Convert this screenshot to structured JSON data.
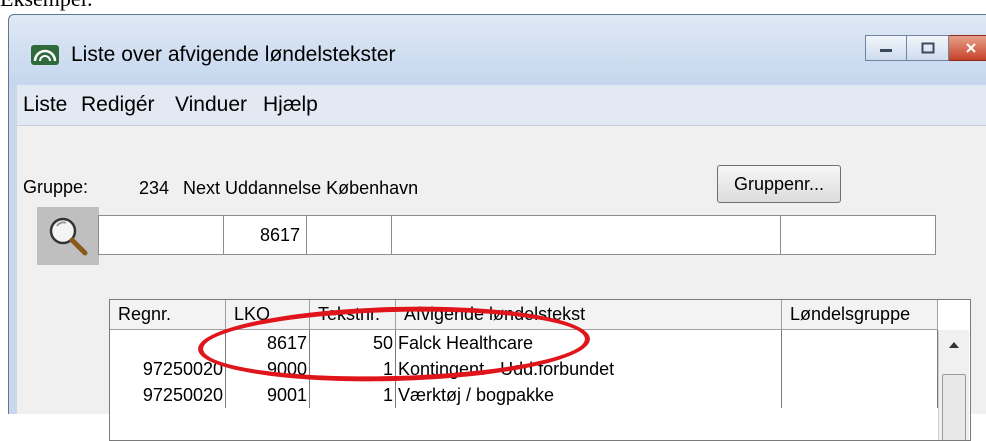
{
  "caption": "Eksempel:",
  "window": {
    "title": "Liste over afvigende løndelstekster",
    "app_icon": "app-logo-icon",
    "buttons": [
      "minimize-icon",
      "maximize-icon",
      "close-icon"
    ]
  },
  "menu": [
    "Liste",
    "Redigér",
    "Vinduer",
    "Hjælp"
  ],
  "group": {
    "label": "Gruppe:",
    "number": "234",
    "name": "Next Uddannelse København"
  },
  "group_button": "Gruppenr...",
  "filter": {
    "regnr": "",
    "lko": "8617",
    "tekstnr": "",
    "text": "",
    "group": ""
  },
  "table": {
    "columns": [
      "Regnr.",
      "LKO",
      "Tekstnr.",
      "Afvigende løndelstekst",
      "Løndelsgruppe"
    ],
    "rows": [
      {
        "regnr": "",
        "lko": "8617",
        "tekstnr": "50",
        "text": "Falck Healthcare",
        "group": ""
      },
      {
        "regnr": "97250020",
        "lko": "9000",
        "tekstnr": "1",
        "text": "Kontingent - Udd.forbundet",
        "group": ""
      },
      {
        "regnr": "97250020",
        "lko": "9001",
        "tekstnr": "1",
        "text": "Værktøj / bogpakke",
        "group": ""
      }
    ]
  },
  "colors": {
    "highlight": "#e0141b",
    "titlebar": "#c9d8ec"
  }
}
